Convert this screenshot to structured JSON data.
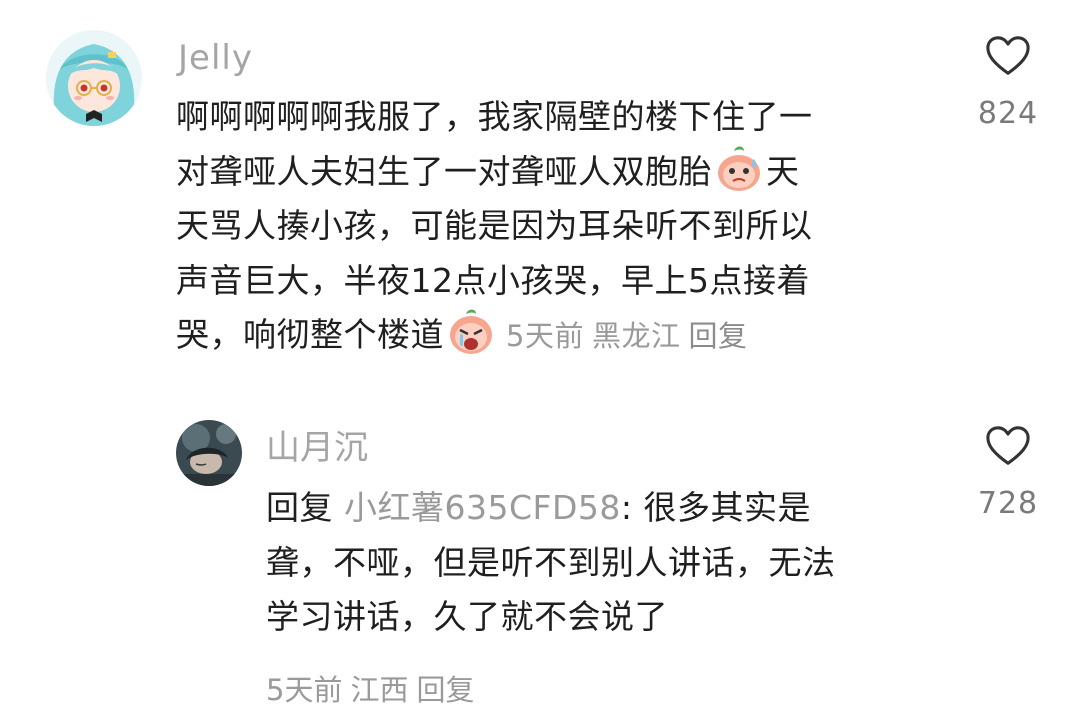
{
  "comments": [
    {
      "username": "Jelly",
      "avatar": "anime-girl-avatar",
      "lines": [
        "啊啊啊啊啊我服了，我家隔壁的楼下住了一",
        "对聋哑人夫妇生了一对聋哑人双胞胎",
        "天",
        "天骂人揍小孩，可能是因为耳朵听不到所以",
        "声音巨大，半夜12点小孩哭，早上5点接着",
        "哭，响彻整个楼道"
      ],
      "stickers": [
        "sweating-face-sticker",
        "crying-face-sticker"
      ],
      "time": "5天前",
      "location": "黑龙江",
      "reply_label": "回复",
      "likes": "824"
    },
    {
      "username": "山月沉",
      "avatar": "dark-portrait-avatar",
      "reply_prefix": "回复 ",
      "reply_to": "小红薯635CFD58",
      "lines": [
        ": 很多其实是",
        "聋，不哑，但是听不到别人讲话，无法",
        "学习讲话，久了就不会说了"
      ],
      "time": "5天前",
      "location": "江西",
      "reply_label": "回复",
      "likes": "728"
    }
  ],
  "colors": {
    "text": "#1f1f1f",
    "muted": "#9a9a9a",
    "background": "#ffffff"
  },
  "icons": {
    "like": "heart-outline-icon"
  }
}
